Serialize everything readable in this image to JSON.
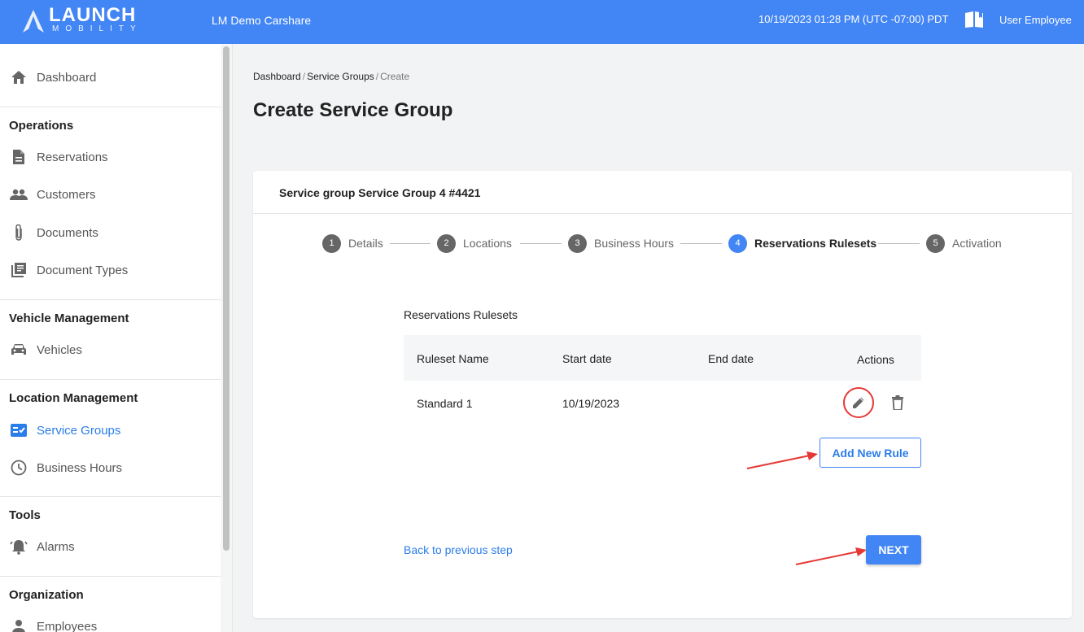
{
  "header": {
    "brand": "LAUNCH",
    "brand_sub": "MOBILITY",
    "org_name": "LM Demo Carshare",
    "datetime": "10/19/2023 01:28 PM (UTC -07:00) PDT",
    "user_name": "User Employee",
    "icons": [
      "launch-logo-icon",
      "book-icon"
    ],
    "bg_color": "#4285f4"
  },
  "sidebar": {
    "dashboard": "Dashboard",
    "sections": [
      {
        "title": "Operations",
        "items": [
          "Reservations",
          "Customers",
          "Documents",
          "Document Types"
        ]
      },
      {
        "title": "Vehicle Management",
        "items": [
          "Vehicles"
        ]
      },
      {
        "title": "Location Management",
        "items": [
          "Service Groups",
          "Business Hours"
        ]
      },
      {
        "title": "Tools",
        "items": [
          "Alarms"
        ]
      },
      {
        "title": "Organization",
        "items": [
          "Employees"
        ]
      }
    ],
    "active_item": "Service Groups",
    "active_color": "#2b7de9"
  },
  "breadcrumb": [
    "Dashboard",
    "Service Groups",
    "Create"
  ],
  "page_title": "Create Service Group",
  "card": {
    "title": "Service group Service Group 4 #4421",
    "steps": [
      {
        "num": "1",
        "label": "Details"
      },
      {
        "num": "2",
        "label": "Locations"
      },
      {
        "num": "3",
        "label": "Business Hours"
      },
      {
        "num": "4",
        "label": "Reservations Rulesets"
      },
      {
        "num": "5",
        "label": "Activation"
      }
    ],
    "active_step": 4,
    "section_title": "Reservations Rulesets",
    "table": {
      "headers": [
        "Ruleset Name",
        "Start date",
        "End date",
        "Actions"
      ],
      "rows": [
        {
          "name": "Standard 1",
          "start": "10/19/2023",
          "end": ""
        }
      ]
    },
    "add_rule_label": "Add New Rule",
    "back_label": "Back to previous step",
    "next_label": "NEXT",
    "highlight_color": "#e53935"
  }
}
